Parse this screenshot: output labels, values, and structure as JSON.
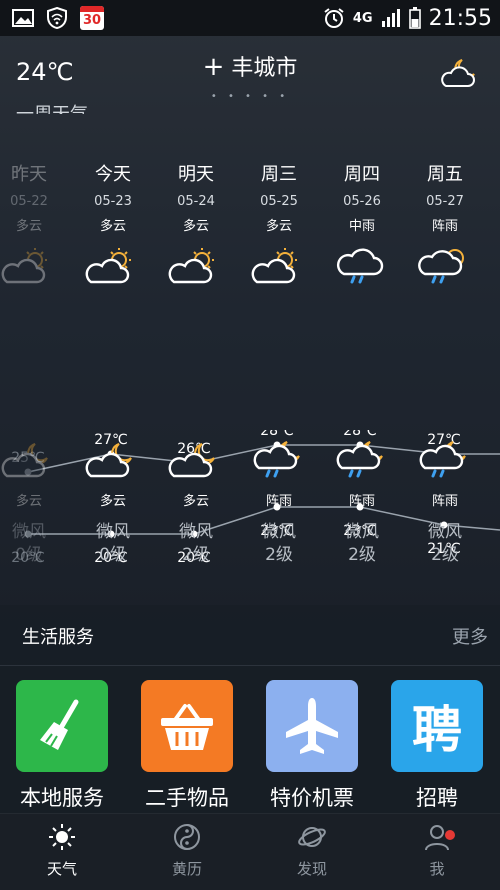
{
  "status": {
    "time": "21:55",
    "network": "4G",
    "calendar_day": "30"
  },
  "header": {
    "current_temp": "24℃",
    "city_prefix": "+",
    "city": "丰城市",
    "page_dots": "• • • • •"
  },
  "cut_title": "一周天气",
  "days": [
    {
      "name": "昨天",
      "date": "05-22",
      "cond": "多云",
      "night_cond": "多云",
      "wind": "微风",
      "wind_level": "0级",
      "high": "25℃",
      "low": "20℃"
    },
    {
      "name": "今天",
      "date": "05-23",
      "cond": "多云",
      "night_cond": "多云",
      "wind": "微风",
      "wind_level": "0级",
      "high": "27℃",
      "low": "20℃"
    },
    {
      "name": "明天",
      "date": "05-24",
      "cond": "多云",
      "night_cond": "多云",
      "wind": "微风",
      "wind_level": "2级",
      "high": "26℃",
      "low": "20℃"
    },
    {
      "name": "周三",
      "date": "05-25",
      "cond": "多云",
      "night_cond": "阵雨",
      "wind": "微风",
      "wind_level": "2级",
      "high": "28℃",
      "low": "23℃"
    },
    {
      "name": "周四",
      "date": "05-26",
      "cond": "中雨",
      "night_cond": "阵雨",
      "wind": "微风",
      "wind_level": "2级",
      "high": "28℃",
      "low": "23℃"
    },
    {
      "name": "周五",
      "date": "05-27",
      "cond": "阵雨",
      "night_cond": "阵雨",
      "wind": "微风",
      "wind_level": "2级",
      "high": "27℃",
      "low": "21℃"
    }
  ],
  "chart_data": {
    "type": "line",
    "categories": [
      "昨天",
      "今天",
      "明天",
      "周三",
      "周四",
      "周五"
    ],
    "series": [
      {
        "values": [
          25,
          27,
          26,
          28,
          28,
          27
        ]
      },
      {
        "values": [
          20,
          20,
          20,
          23,
          23,
          21
        ]
      }
    ]
  },
  "services": {
    "title": "生活服务",
    "more": "更多",
    "items": [
      {
        "label": "本地服务",
        "color": "#2db74a"
      },
      {
        "label": "二手物品",
        "color": "#f47a24"
      },
      {
        "label": "特价机票",
        "color": "#8cb0ef"
      },
      {
        "label": "招聘",
        "color": "#2aa5ea"
      }
    ]
  },
  "tabs": [
    {
      "label": "天气",
      "active": true
    },
    {
      "label": "黄历",
      "active": false
    },
    {
      "label": "发现",
      "active": false
    },
    {
      "label": "我",
      "active": false
    }
  ]
}
